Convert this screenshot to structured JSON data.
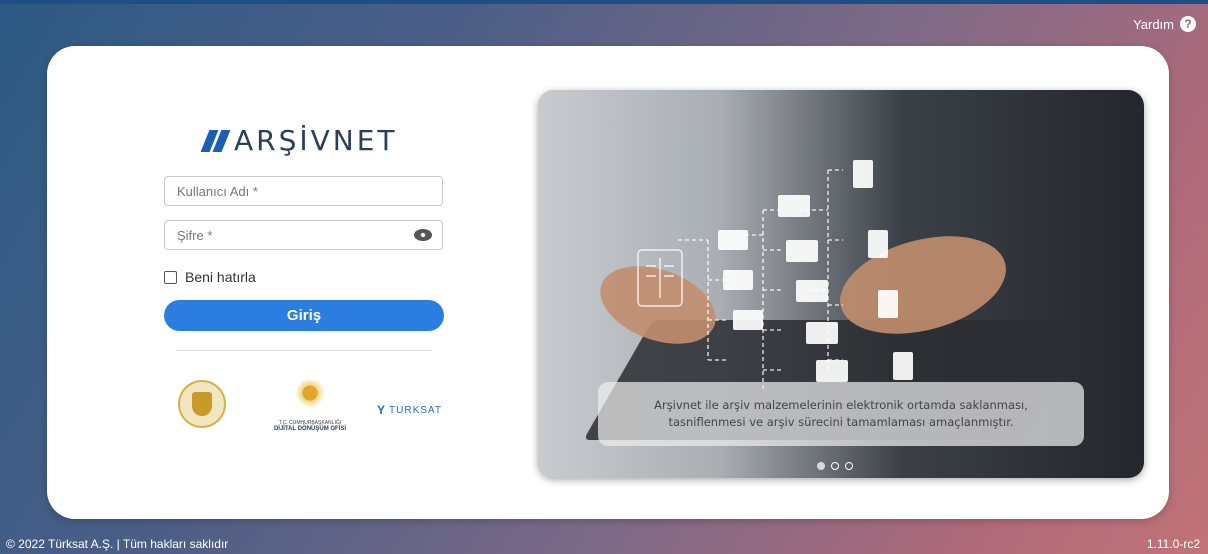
{
  "header": {
    "help_label": "Yardım",
    "help_icon": "question-circle-icon"
  },
  "brand": {
    "logo_text": "ARŞİVNET"
  },
  "form": {
    "username_placeholder": "Kullanıcı Adı *",
    "username_value": "",
    "password_placeholder": "Şifre *",
    "password_value": "",
    "remember_label": "Beni hatırla",
    "login_label": "Giriş"
  },
  "partners": {
    "dijital_line1": "T.C. CUMHURBAŞKANLIĞI",
    "dijital_line2": "DİJİTAL DÖNÜŞÜM OFİSİ",
    "turksat_text": "TURKSAT"
  },
  "carousel": {
    "caption": "Arşivnet ile arşiv malzemelerinin elektronik ortamda saklanması, tasniflenmesi ve arşiv sürecini tamamlaması amaçlanmıştır.",
    "slides": 3,
    "active_slide": 1
  },
  "footer": {
    "copyright": "© 2022 Türksat A.Ş. | Tüm hakları saklıdır",
    "version": "1.11.0-rc2"
  },
  "colors": {
    "primary": "#2c7de0",
    "brand_blue": "#1a5fb4",
    "logo_text": "#2a3f5c"
  }
}
